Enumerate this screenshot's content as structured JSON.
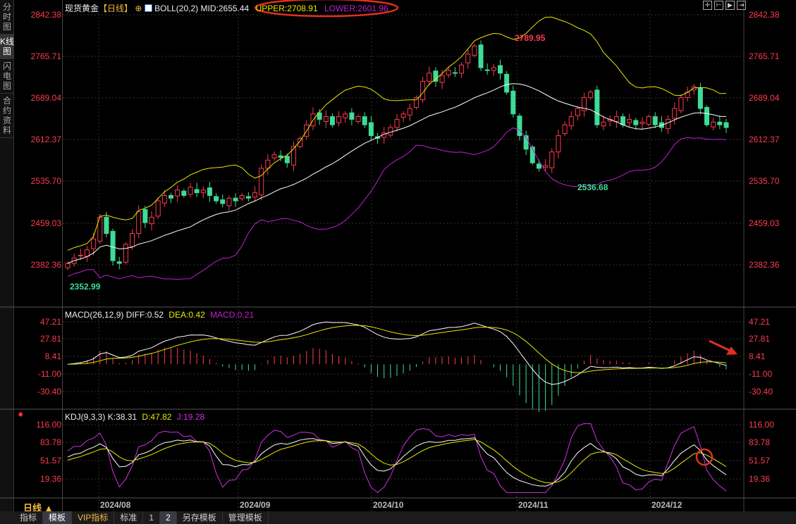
{
  "sidebar": {
    "tabs": [
      {
        "label": "分时图"
      },
      {
        "label": "K线图"
      },
      {
        "label": "闪电图"
      },
      {
        "label": "合约资料"
      }
    ]
  },
  "header": {
    "instrument": "现货黄金",
    "period": "【日线】",
    "indicator": "BOLL(20,2)",
    "mid": "MID:2655.44",
    "upper": "UPPER:2708.91",
    "lower": "LOWER:2601.96"
  },
  "macd_header": {
    "name": "MACD(26,12,9)",
    "diff": "DIFF:0.52",
    "dea": "DEA:0.42",
    "macd": "MACD:0.21"
  },
  "kdj_header": {
    "name": "KDJ(9,3,3)",
    "k": "K:38.31",
    "d": "D:47.82",
    "j": "J:19.28"
  },
  "price_axis": [
    "2842.38",
    "2765.71",
    "2689.04",
    "2612.37",
    "2535.70",
    "2459.03",
    "2382.36"
  ],
  "macd_axis": [
    "47.21",
    "27.81",
    "8.41",
    "-11.00",
    "-30.40"
  ],
  "kdj_axis": [
    "116.00",
    "83.78",
    "51.57",
    "19.36"
  ],
  "dates": [
    "2024/08",
    "2024/09",
    "2024/10",
    "2024/11",
    "2024/12"
  ],
  "period_label": "日线 ▲",
  "annotations": {
    "high": "2789.95",
    "low1": "2536.68",
    "low2": "2352.99"
  },
  "bottom_tabs": [
    {
      "label": "指标"
    },
    {
      "label": "模板"
    },
    {
      "label": "VIP指标"
    },
    {
      "label": "标准"
    },
    {
      "label": "1"
    },
    {
      "label": "2"
    },
    {
      "label": "另存模板"
    },
    {
      "label": "管理模板"
    }
  ],
  "colors": {
    "up": "#ff3b4f",
    "down": "#3ddc97",
    "upper": "#e8e800",
    "lower": "#c020d0",
    "mid": "#ffffff",
    "mark": "#e03020"
  },
  "chart_data": {
    "type": "candlestick",
    "closes": [
      2385,
      2395,
      2400,
      2410,
      2430,
      2470,
      2440,
      2390,
      2385,
      2420,
      2440,
      2480,
      2460,
      2470,
      2500,
      2510,
      2505,
      2520,
      2510,
      2525,
      2515,
      2520,
      2510,
      2500,
      2495,
      2505,
      2500,
      2510,
      2505,
      2515,
      2560,
      2575,
      2585,
      2580,
      2570,
      2600,
      2615,
      2640,
      2660,
      2650,
      2655,
      2640,
      2655,
      2660,
      2650,
      2655,
      2640,
      2620,
      2615,
      2625,
      2635,
      2650,
      2660,
      2670,
      2690,
      2720,
      2735,
      2720,
      2730,
      2740,
      2735,
      2750,
      2770,
      2785,
      2745,
      2740,
      2745,
      2735,
      2700,
      2660,
      2620,
      2595,
      2570,
      2560,
      2565,
      2590,
      2620,
      2640,
      2655,
      2670,
      2690,
      2700,
      2640,
      2645,
      2650,
      2655,
      2640,
      2650,
      2640,
      2645,
      2655,
      2640,
      2635,
      2650,
      2670,
      2690,
      2700,
      2710,
      2670,
      2640,
      2645,
      2640,
      2635
    ]
  }
}
